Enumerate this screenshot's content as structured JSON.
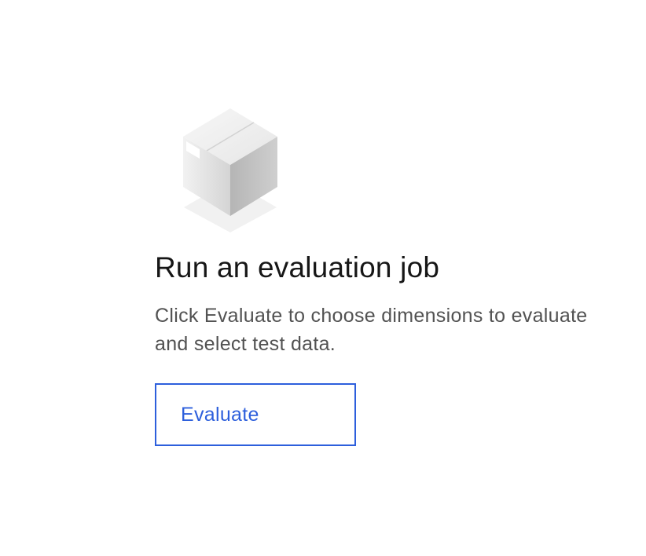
{
  "empty_state": {
    "icon": "package-box-icon",
    "title": "Run an evaluation job",
    "description": "Click Evaluate to choose dimensions to evaluate and select test data.",
    "button_label": "Evaluate"
  },
  "colors": {
    "accent": "#2d5fdc",
    "title_text": "#161616",
    "body_text": "#525252",
    "background": "#ffffff"
  }
}
